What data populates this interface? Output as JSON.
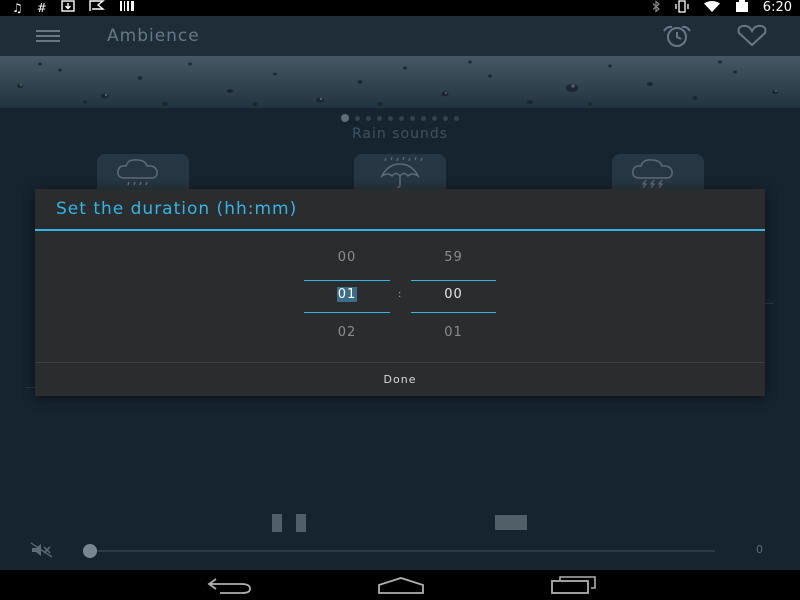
{
  "status_bar": {
    "left_icons": [
      "music-note-icon",
      "hash-icon",
      "download-icon",
      "flag-icon",
      "barcode-icon"
    ],
    "right_icons": [
      "bluetooth-icon",
      "vibrate-icon",
      "wifi-icon",
      "battery-icon"
    ],
    "time": "6:20"
  },
  "toolbar": {
    "title": "Ambience",
    "icons": [
      "menu-icon",
      "alarm-clock-icon",
      "heart-icon"
    ]
  },
  "carousel": {
    "page_count": 11,
    "active_index": 0,
    "category": "Rain sounds"
  },
  "sound_tiles": [
    "rain-cloud-icon",
    "umbrella-rain-icon",
    "thunderstorm-cloud-icon"
  ],
  "player": {
    "volume": 0,
    "volume_label": "0",
    "icons": [
      "pause-icon",
      "stop-icon",
      "mute-icon"
    ]
  },
  "dialog": {
    "title": "Set the duration (hh:mm)",
    "hours": {
      "prev": "00",
      "current": "01",
      "next": "02"
    },
    "minutes": {
      "prev": "59",
      "current": "00",
      "next": "01"
    },
    "separator": ":",
    "done_label": "Done"
  },
  "nav_bar": {
    "icons": [
      "back-icon",
      "home-icon",
      "recents-icon"
    ]
  },
  "colors": {
    "accent": "#33b5e5",
    "app_background": "#1e3141",
    "dialog_background": "#2b2c2e"
  }
}
